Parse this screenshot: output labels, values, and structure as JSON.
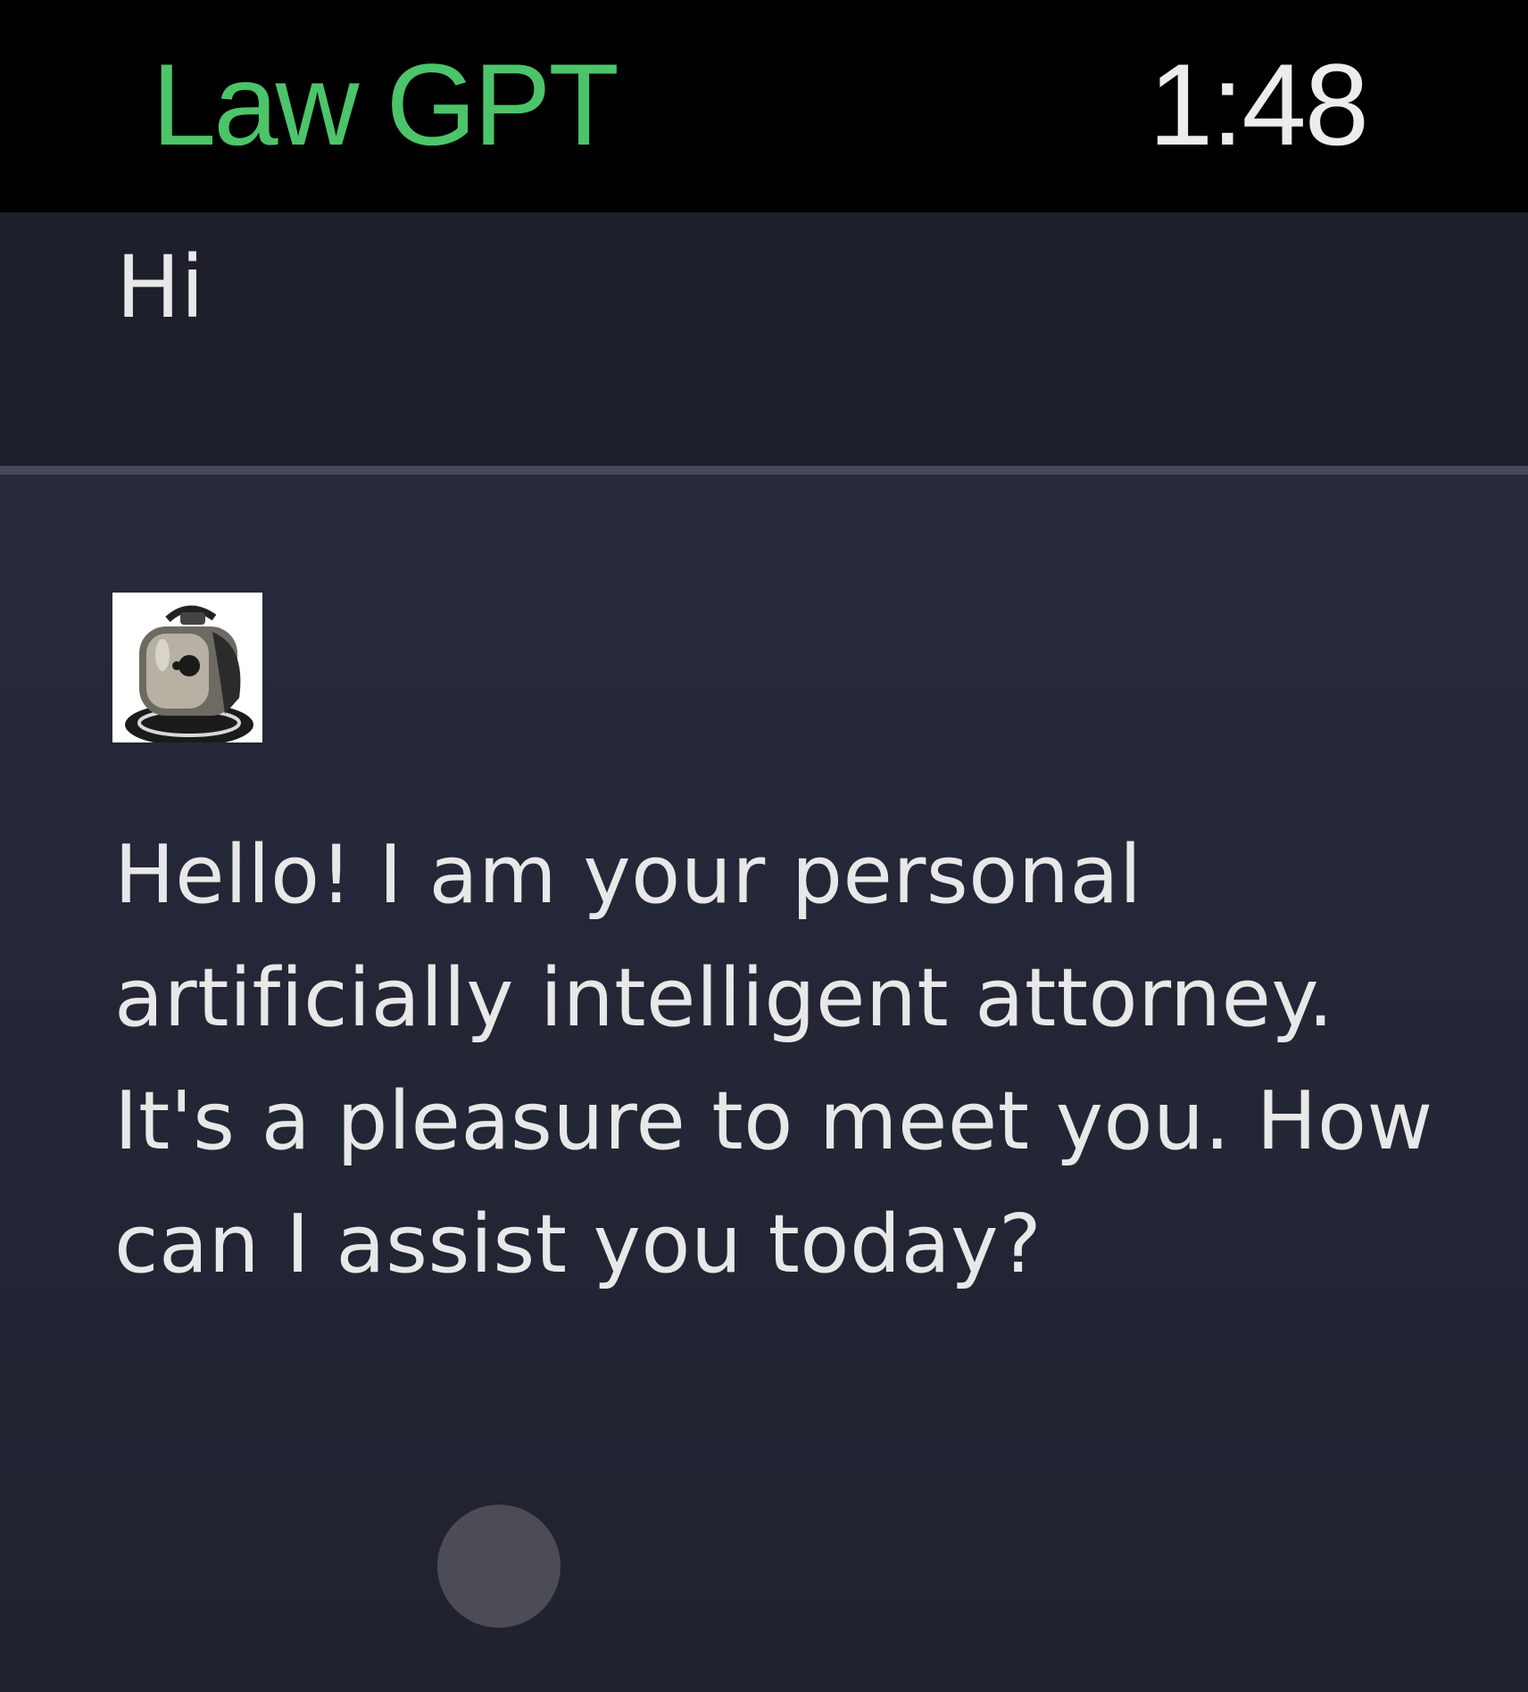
{
  "status_bar": {
    "app_title": "Law GPT",
    "time": "1:48"
  },
  "chat": {
    "user_message": "Hi",
    "assistant_avatar": "robot-attorney-avatar",
    "assistant_message": "Hello! I am your personal artificially intelligent attorney. It's a pleasure to meet you. How can I assist you today?"
  },
  "colors": {
    "accent": "#4cc46a",
    "background": "#000000",
    "user_bubble": "#1d1f2b",
    "assistant_bubble": "#262939",
    "text": "#e8e8e8"
  }
}
